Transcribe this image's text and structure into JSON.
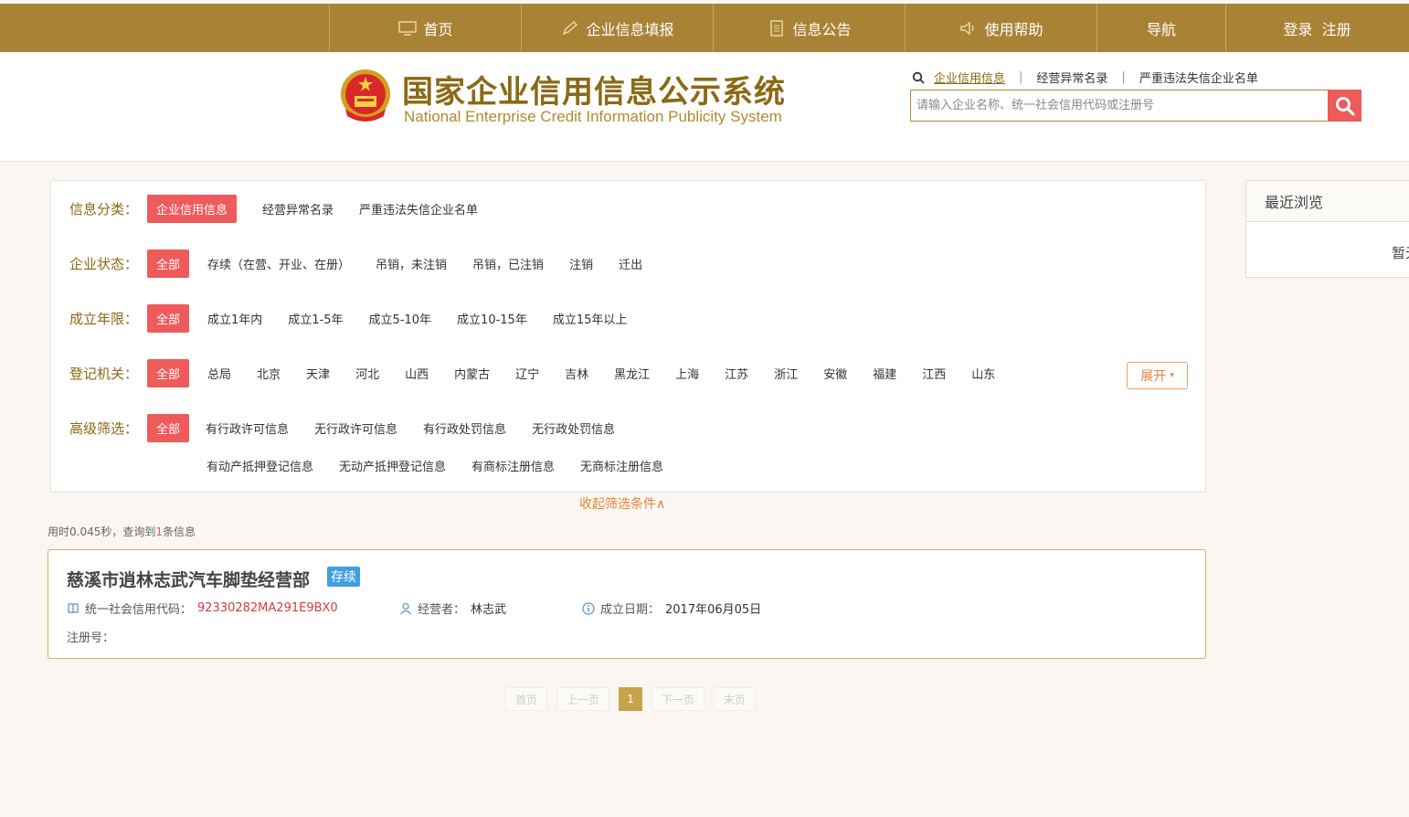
{
  "nav": {
    "items": [
      {
        "label": "首页",
        "icon": "monitor-icon"
      },
      {
        "label": "企业信息填报",
        "icon": "pen-icon"
      },
      {
        "label": "信息公告",
        "icon": "document-icon"
      },
      {
        "label": "使用帮助",
        "icon": "speaker-icon"
      },
      {
        "label": "导航"
      },
      {
        "label": "登录  注册"
      }
    ]
  },
  "header": {
    "title_cn": "国家企业信用信息公示系统",
    "title_en": "National Enterprise Credit Information Publicity System",
    "search_tabs": [
      "企业信用信息",
      "经营异常名录",
      "严重违法失信企业名单"
    ],
    "search_placeholder": "请输入企业名称、统一社会信用代码或注册号"
  },
  "filters": {
    "category": {
      "label": "信息分类：",
      "options": [
        "企业信用信息",
        "经营异常名录",
        "严重违法失信企业名单"
      ]
    },
    "status": {
      "label": "企业状态：",
      "options": [
        "全部",
        "存续（在营、开业、在册）",
        "吊销，未注销",
        "吊销，已注销",
        "注销",
        "迁出"
      ]
    },
    "years": {
      "label": "成立年限：",
      "options": [
        "全部",
        "成立1年内",
        "成立1-5年",
        "成立5-10年",
        "成立10-15年",
        "成立15年以上"
      ]
    },
    "authority": {
      "label": "登记机关：",
      "options": [
        "全部",
        "总局",
        "北京",
        "天津",
        "河北",
        "山西",
        "内蒙古",
        "辽宁",
        "吉林",
        "黑龙江",
        "上海",
        "江苏",
        "浙江",
        "安徽",
        "福建",
        "江西",
        "山东"
      ],
      "expand": "展开"
    },
    "advanced": {
      "label": "高级筛选：",
      "options_row1": [
        "全部",
        "有行政许可信息",
        "无行政许可信息",
        "有行政处罚信息",
        "无行政处罚信息"
      ],
      "options_row2": [
        "有动产抵押登记信息",
        "无动产抵押登记信息",
        "有商标注册信息",
        "无商标注册信息"
      ]
    },
    "collapse": "收起筛选条件∧"
  },
  "stats": {
    "prefix": "用时0.045秒，查询到",
    "count": "1",
    "suffix": "条信息"
  },
  "result": {
    "name": "慈溪市逍林志武汽车脚垫经营部",
    "status": "存续",
    "credit_label": "统一社会信用代码：",
    "credit_code": "92330282MA291E9BX0",
    "operator_label": "经营者：",
    "operator": "林志武",
    "date_label": "成立日期：",
    "date": "2017年06月05日",
    "reg_label": "注册号："
  },
  "pager": [
    "首页",
    "上一页",
    "1",
    "下一页",
    "末页"
  ],
  "recent": {
    "title": "最近浏览",
    "body": "暂无"
  },
  "colors": {
    "nav_bg": "#a98335",
    "accent_red": "#ef5a5a",
    "gold_text": "#8b6914",
    "badge_blue": "#3f9fe0"
  }
}
